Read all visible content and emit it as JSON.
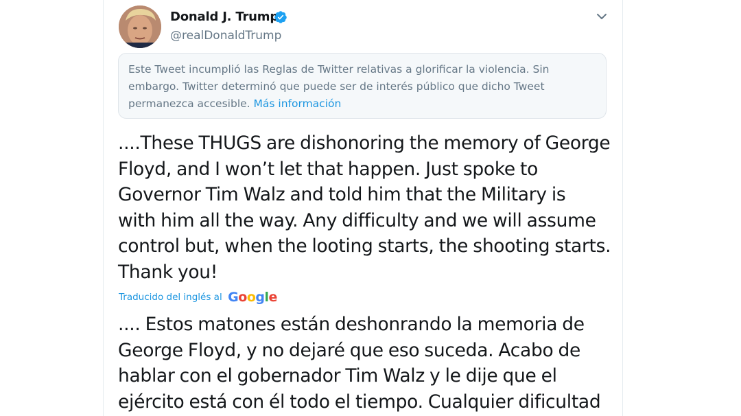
{
  "author": {
    "name": "Donald J. Trump",
    "handle": "@realDonaldTrump",
    "verified": true,
    "verified_icon": "verified-badge-icon",
    "verified_color": "#1da1f2"
  },
  "menu_icon": "chevron-down-icon",
  "notice": {
    "text": "Este Tweet incumplió las Reglas de Twitter relativas a glorificar la violencia. Sin embargo. Twitter determinó que puede ser de interés público que dicho Tweet permanezca accesible.",
    "link_text": "Más información",
    "link_color": "#1b95e0",
    "background": "#f5f8fa"
  },
  "tweet": {
    "lines": [
      "....These THUGS are dishonoring the memory of George",
      "Floyd, and I won’t let that happen. Just spoke to",
      "Governor Tim Walz and told him that the Military is",
      "with him all the way. Any difficulty and we will assume",
      "control but, when the looting starts, the shooting starts.",
      "Thank you!"
    ]
  },
  "translation": {
    "label": "Traducido del inglés al",
    "provider": [
      "G",
      "o",
      "o",
      "g",
      "l",
      "e"
    ],
    "provider_colors": [
      "#4285f4",
      "#ea4335",
      "#fbbc05",
      "#4285f4",
      "#34a853",
      "#ea4335"
    ],
    "lines": [
      ".... Estos matones están deshonrando la memoria de",
      "George Floyd, y no dejaré que eso suceda. Acabo de",
      "hablar con el gobernador Tim Walz y le dije que el",
      "ejército está con él todo el tiempo. Cualquier dificultad"
    ]
  }
}
